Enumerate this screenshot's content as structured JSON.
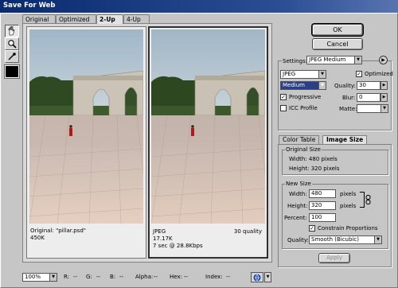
{
  "window": {
    "title": "Save For Web"
  },
  "tabs": [
    {
      "label": "Original"
    },
    {
      "label": "Optimized"
    },
    {
      "label": "2-Up"
    },
    {
      "label": "4-Up"
    }
  ],
  "active_tab": "2-Up",
  "panes": {
    "original": {
      "line1": "Original: \"pillar.psd\"",
      "line2": "450K"
    },
    "optimized": {
      "line1": "JPEG",
      "line2": "17.17K",
      "line3": "7 sec @ 28.8Kbps",
      "quality": "30 quality"
    }
  },
  "buttons": {
    "ok": "OK",
    "cancel": "Cancel",
    "apply": "Apply"
  },
  "settings": {
    "label": "Settings:",
    "preset": "JPEG Medium",
    "format": "JPEG",
    "optimized_label": "Optimized",
    "optimized_checked": "✓",
    "quality_level": "Medium",
    "quality_label": "Quality:",
    "quality_value": "30",
    "progressive_label": "Progressive",
    "progressive_checked": "✓",
    "blur_label": "Blur:",
    "blur_value": "0",
    "icc_label": "ICC Profile",
    "matte_label": "Matte:",
    "matte_value": ""
  },
  "right_tabs": [
    {
      "label": "Color Table"
    },
    {
      "label": "Image Size"
    }
  ],
  "original_size": {
    "title": "Original Size",
    "width": "Width:  480 pixels",
    "height": "Height:  320 pixels"
  },
  "new_size": {
    "title": "New Size",
    "width_label": "Width:",
    "width_value": "480",
    "width_unit": "pixels",
    "height_label": "Height:",
    "height_value": "320",
    "height_unit": "pixels",
    "percent_label": "Percent:",
    "percent_value": "100",
    "constrain_label": "Constrain Proportions",
    "constrain_checked": "✓",
    "quality_label": "Quality:",
    "quality_value": "Smooth (Bicubic)"
  },
  "status": {
    "zoom": "100%",
    "r": "R:",
    "r_val": "--",
    "g": "G:",
    "g_val": "--",
    "b": "B:",
    "b_val": "--",
    "alpha": "Alpha:",
    "alpha_val": "--",
    "hex": "Hex:",
    "hex_val": "--",
    "index": "Index:",
    "index_val": "--"
  },
  "colors": {
    "title_bar": "#0a2a6e",
    "panel": "#c6c6c6",
    "sky": "#a6b8c6",
    "plaza": "#d8c4b4"
  }
}
